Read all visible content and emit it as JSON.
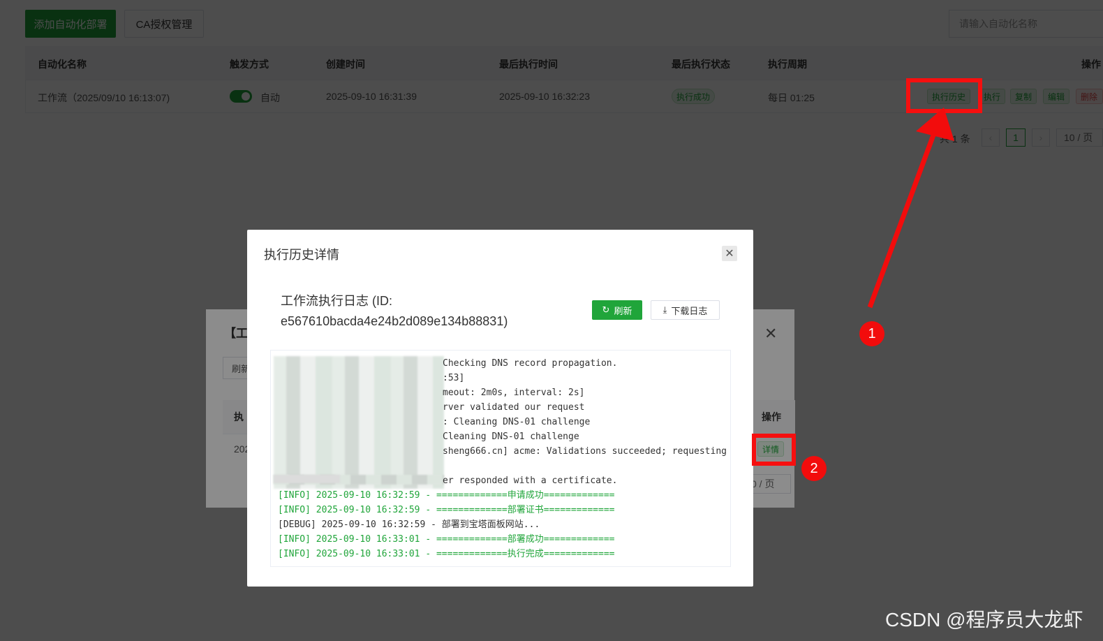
{
  "toolbar": {
    "add_label": "添加自动化部署",
    "ca_label": "CA授权管理",
    "search_placeholder": "请输入自动化名称"
  },
  "table": {
    "headers": [
      "自动化名称",
      "触发方式",
      "创建时间",
      "最后执行时间",
      "最后执行状态",
      "执行周期",
      "操作"
    ],
    "row": {
      "name": "工作流（2025/09/10 16:13:07)",
      "trigger": "自动",
      "created": "2025-09-10 16:31:39",
      "last_run": "2025-09-10 16:32:23",
      "status": "执行成功",
      "cycle": "每日 01:25",
      "actions": [
        "执行历史",
        "执行",
        "复制",
        "编辑",
        "删除"
      ]
    }
  },
  "pager": {
    "total": "共 1 条",
    "prev": "‹",
    "page": "1",
    "next": "›",
    "size": "10 / 页"
  },
  "dialog2": {
    "title_fragment": "【工",
    "refresh_fragment": "刷新",
    "col_fragment": "执",
    "actions_header": "操作",
    "date_fragment": "202",
    "detail_button": "详情",
    "size_fragment": "0 / 页"
  },
  "dialog1": {
    "title": "执行历史详情",
    "log_title_line1": "工作流执行日志 (ID:",
    "log_title_line2": "e567610bacda4e24b2d089e134b88831)",
    "refresh_button": "刷新",
    "download_button": "下载日志",
    "log_lines": [
      {
        "text": "Checking DNS record propagation.",
        "green": false
      },
      {
        "text": ":53]",
        "green": false
      },
      {
        "text": "meout: 2m0s, interval: 2s]",
        "green": false
      },
      {
        "text": "rver validated our request",
        "green": false
      },
      {
        "text": ": Cleaning DNS-01 challenge",
        "green": false
      },
      {
        "text": "Cleaning DNS-01 challenge",
        "green": false
      },
      {
        "text": "sheng666.cn] acme: Validations succeeded; requesting",
        "green": false
      },
      {
        "text": "",
        "green": false
      },
      {
        "text": "er responded with a certificate.",
        "green": false
      },
      {
        "text": "[INFO] 2025-09-10 16:32:59 - =============申请成功=============",
        "green": true
      },
      {
        "text": "[INFO] 2025-09-10 16:32:59 - =============部署证书=============",
        "green": true
      },
      {
        "text": "[DEBUG] 2025-09-10 16:32:59 - 部署到宝塔面板网站...",
        "green": false
      },
      {
        "text": "[INFO] 2025-09-10 16:33:01 - =============部署成功=============",
        "green": true
      },
      {
        "text": "[INFO] 2025-09-10 16:33:01 - =============执行完成=============",
        "green": true
      }
    ]
  },
  "annotations": {
    "badge1": "1",
    "badge2": "2",
    "accent": "#f20c0c"
  },
  "watermark": "CSDN @程序员大龙虾",
  "colors": {
    "primary": "#20a53a",
    "mask": "rgba(0,0,0,0.45)"
  },
  "icons": {
    "close": "close-icon",
    "refresh": "refresh-icon",
    "download": "download-icon"
  }
}
